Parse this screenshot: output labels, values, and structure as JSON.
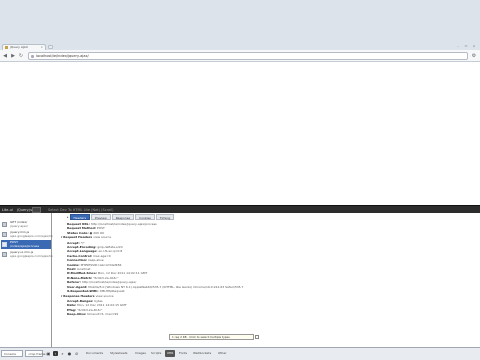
{
  "browser": {
    "tab_title": "jQuery AJAX",
    "tab_close": "×",
    "url": "localhost/ie/index/jquery-ajax/",
    "window_buttons": [
      "–",
      "▭",
      "×"
    ],
    "icons": {
      "back": "back-arrow-icon",
      "forward": "forward-arrow-icon",
      "reload": "reload-icon",
      "wrench": "wrench-icon"
    }
  },
  "devtools": {
    "tabbar": {
      "left_label": "Lite-ui",
      "jquery_label": "jQuery.js",
      "menu_items": "Select Dev To HTML Lite (Net) (Scroll)"
    },
    "requests": [
      {
        "line1": "GET /index/",
        "line2": "jquery-ajax/",
        "selected": false
      },
      {
        "line1": "jquery.min.js",
        "line2": "ajax.googleapis.com/ajax/lib",
        "selected": false
      },
      {
        "line1": "POST",
        "line2": "/index/ajax/process",
        "selected": true
      },
      {
        "line1": "jquery-ui.min.js",
        "line2": "ajax.googleapis.com/ajax/lib",
        "selected": false
      }
    ],
    "subtabs": [
      "Headers",
      "Preview",
      "Response",
      "Cookies",
      "Timing"
    ],
    "active_subtab_index": 0,
    "subtab_arrow": "▸",
    "details": {
      "general": [
        {
          "key": "Request URL:",
          "value": "http://localhost/ie/index/jquery-ajax/process"
        },
        {
          "key": "Request Method:",
          "value": "POST"
        },
        {
          "key": "Status Code:",
          "value": "● 200 OK"
        }
      ],
      "request_headers_title": "Request Headers",
      "request_headers_note": "view source",
      "request_headers": [
        {
          "key": "Accept:",
          "value": "*/*"
        },
        {
          "key": "Accept-Encoding:",
          "value": "gzip,deflate,sdch"
        },
        {
          "key": "Accept-Language:",
          "value": "en-US,en;q=0.8"
        },
        {
          "key": "Cache-Control:",
          "value": "max-age=0"
        },
        {
          "key": "Connection:",
          "value": "keep-alive"
        },
        {
          "key": "Cookie:",
          "value": "PHPSESSID=abc123def456"
        },
        {
          "key": "Host:",
          "value": "localhost"
        },
        {
          "key": "If-Modified-Since:",
          "value": "Mon, 12 Dec 2011 14:02:11 GMT"
        },
        {
          "key": "If-None-Match:",
          "value": "\"6c0b3-2a-4b3c\""
        },
        {
          "key": "Referer:",
          "value": "http://localhost/ie/index/jquery-ajax/"
        },
        {
          "key": "User-Agent:",
          "value": "Mozilla/5.0 (Windows NT 6.1) AppleWebKit/535.7 (KHTML, like Gecko) Chrome/16.0.912.63 Safari/535.7"
        },
        {
          "key": "X-Requested-With:",
          "value": "XMLHttpRequest"
        }
      ],
      "response_headers_title": "Response Headers",
      "response_headers_note": "view source",
      "response_headers": [
        {
          "key": "Accept-Ranges:",
          "value": "bytes"
        },
        {
          "key": "Date:",
          "value": "Mon, 12 Dec 2011 14:02:15 GMT"
        },
        {
          "key": "ETag:",
          "value": "\"6c0b3-2a-4b3c\""
        },
        {
          "key": "Keep-Alive:",
          "value": "timeout=5, max=99"
        }
      ]
    },
    "bottombar": {
      "console_label": "Console",
      "frame_dropdown": "<top frame>",
      "filters": [
        "Documents",
        "Stylesheets",
        "Images",
        "Scripts",
        "XHR",
        "Fonts",
        "WebSockets",
        "Other"
      ],
      "active_filter_index": 4,
      "tooltip": "1 req 2 KB · Click to select multiple types"
    }
  }
}
